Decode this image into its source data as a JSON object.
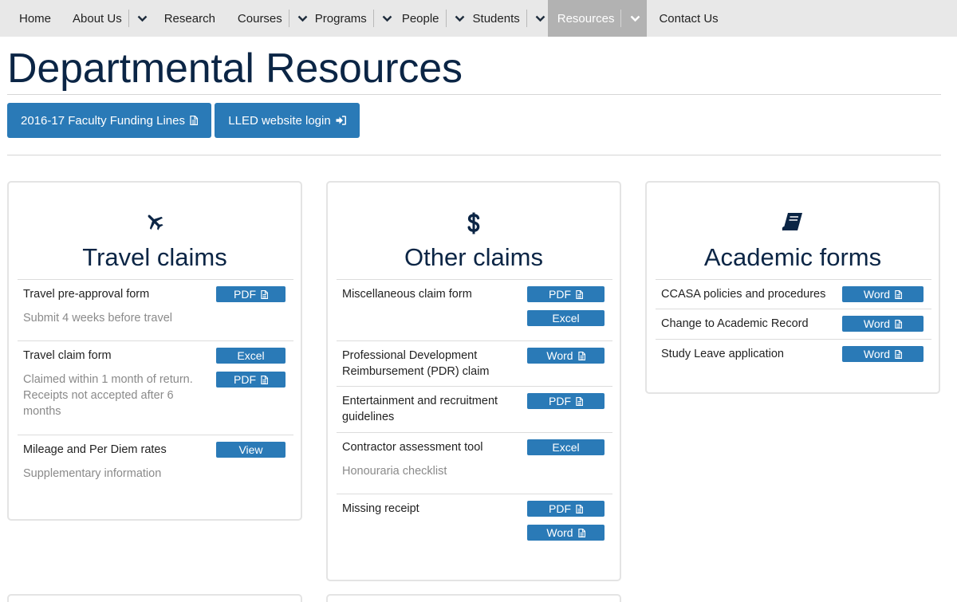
{
  "nav": {
    "items": [
      {
        "label": "Home"
      },
      {
        "label": "About Us"
      },
      {
        "label": "Research"
      },
      {
        "label": "Courses"
      },
      {
        "label": "Programs"
      },
      {
        "label": "People"
      },
      {
        "label": "Students"
      },
      {
        "label": "Resources"
      },
      {
        "label": "Contact Us"
      }
    ]
  },
  "page": {
    "title": "Departmental Resources"
  },
  "top_buttons": {
    "funding": "2016-17 Faculty Funding Lines",
    "login": "LLED website login"
  },
  "icons": {
    "file": "file-icon",
    "sign_in": "sign-in-icon",
    "plane": "plane-icon",
    "dollar": "dollar-icon",
    "book": "book-icon",
    "caret": "chevron-down-icon"
  },
  "colors": {
    "primary": "#2a7ab7",
    "title": "#0b2545",
    "nav_bg": "#e8e8e8",
    "nav_active": "#b2b2b2"
  },
  "cards": {
    "travel": {
      "title": "Travel claims",
      "rows": [
        {
          "label": "Travel pre-approval form",
          "sub": "Submit 4 weeks before travel",
          "buttons": [
            "PDF"
          ]
        },
        {
          "label": "Travel claim form",
          "sub": "Claimed within 1 month of return. Receipts not accepted after 6 months",
          "buttons": [
            "Excel",
            "PDF"
          ]
        },
        {
          "label": "Mileage and Per Diem rates",
          "sub": "Supplementary information",
          "buttons": [
            "View"
          ]
        }
      ]
    },
    "other": {
      "title": "Other claims",
      "rows": [
        {
          "label": "Miscellaneous claim form",
          "buttons": [
            "PDF",
            "Excel"
          ]
        },
        {
          "label": "Professional Development Reimbursement (PDR) claim",
          "buttons": [
            "Word"
          ]
        },
        {
          "label": "Entertainment and recruitment guidelines",
          "buttons": [
            "PDF"
          ]
        },
        {
          "label": "Contractor assessment tool",
          "sub": "Honouraria checklist",
          "buttons": [
            "Excel"
          ]
        },
        {
          "label": "Missing receipt",
          "buttons": [
            "PDF",
            "Word"
          ]
        }
      ]
    },
    "academic": {
      "title": "Academic forms",
      "rows": [
        {
          "label": "CCASA policies and procedures",
          "buttons": [
            "Word"
          ]
        },
        {
          "label": "Change to Academic Record",
          "buttons": [
            "Word"
          ]
        },
        {
          "label": "Study Leave application",
          "buttons": [
            "Word"
          ]
        }
      ]
    }
  }
}
